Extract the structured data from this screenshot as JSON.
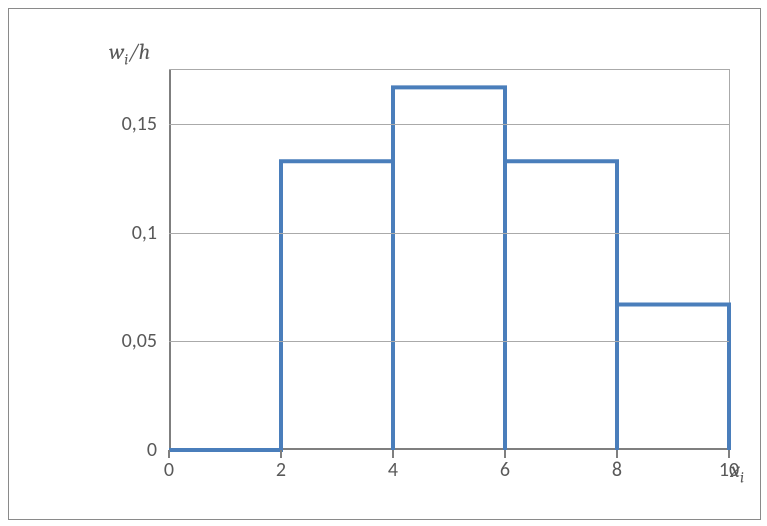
{
  "chart_data": {
    "type": "bar",
    "title": "",
    "xlabel": "xᵢ",
    "ylabel": "wᵢ/h",
    "xlim": [
      0,
      10
    ],
    "ylim": [
      0,
      0.175
    ],
    "x_ticks": [
      0,
      2,
      4,
      6,
      8,
      10
    ],
    "y_ticks": [
      0,
      0.05,
      0.1,
      0.15
    ],
    "y_tick_labels": [
      "0",
      "0,05",
      "0,1",
      "0,15"
    ],
    "grid": {
      "y": true,
      "x": false
    },
    "series": [
      {
        "name": "wi_over_h",
        "color": "#4a7ebb",
        "bins": [
          {
            "from": 0,
            "to": 1,
            "value": 0.0
          },
          {
            "from": 1,
            "to": 2,
            "value": 0.0
          },
          {
            "from": 2,
            "to": 4,
            "value": 0.133
          },
          {
            "from": 4,
            "to": 6,
            "value": 0.167
          },
          {
            "from": 6,
            "to": 8,
            "value": 0.133
          },
          {
            "from": 8,
            "to": 10,
            "value": 0.067
          }
        ]
      }
    ],
    "ylabel_html": "<span style=\"font-style:italic\">w<sub style=\"font-style:italic;font-size:70%\">i</sub></span>/<span style=\"font-style:italic\">h</span>",
    "xlabel_html": "<span style=\"font-style:italic\">x<sub style=\"font-style:italic;font-size:70%\">i</sub></span>"
  }
}
